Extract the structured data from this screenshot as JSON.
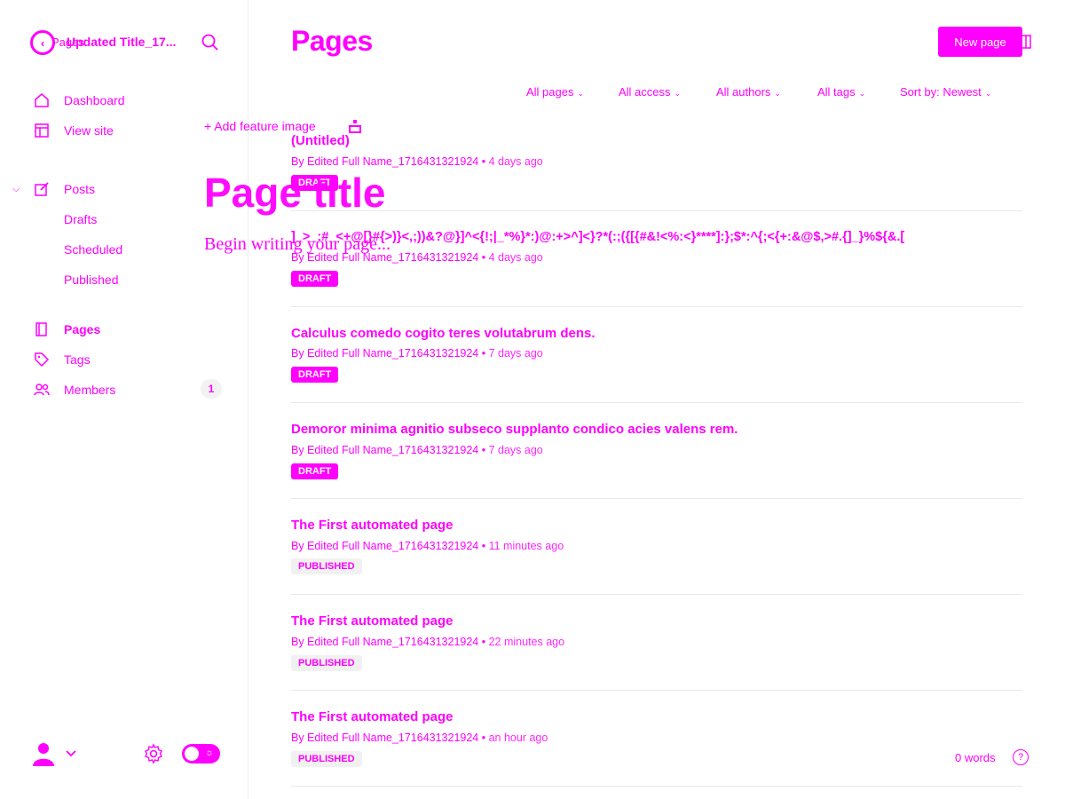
{
  "editor": {
    "back_label": "Pages",
    "breadcrumb_title": "Updated Title_17...",
    "add_feature_image": "Add feature image",
    "title_placeholder": "Page title",
    "body_placeholder": "Begin writing your page...",
    "word_count": "0 words",
    "help_icon": "?"
  },
  "sidebar": {
    "items": [
      {
        "label": "Dashboard",
        "icon": "home-icon"
      },
      {
        "label": "View site",
        "icon": "layout-icon"
      },
      {
        "label": "Posts",
        "icon": "edit-icon"
      },
      {
        "label": "Drafts"
      },
      {
        "label": "Scheduled"
      },
      {
        "label": "Published"
      },
      {
        "label": "Pages",
        "icon": "page-icon"
      },
      {
        "label": "Tags",
        "icon": "tag-icon"
      },
      {
        "label": "Members",
        "icon": "members-icon",
        "count": "1"
      }
    ]
  },
  "header": {
    "title": "Pages",
    "new_page_label": "New page"
  },
  "filters": {
    "pages": "All pages",
    "access": "All access",
    "authors": "All authors",
    "tags": "All tags",
    "sort": "Sort by: Newest"
  },
  "list": [
    {
      "title": "(Untitled)",
      "meta": "By Edited Full Name_1716431321924",
      "ago": "4 days ago",
      "status": "DRAFT"
    },
    {
      "title": "]_>_:#_<+@[}#{>)}<,;))&?@}]^<{!;|_*%}*:)@:+>^]<}?*(:;({[{#&!<%:<}****]:};$*:^{;<{+:&@$,>#.{]_}%${&.[",
      "meta": "By Edited Full Name_1716431321924",
      "ago": "4 days ago",
      "status": "DRAFT"
    },
    {
      "title": "Calculus comedo cogito teres volutabrum dens.",
      "meta": "By Edited Full Name_1716431321924",
      "ago": "7 days ago",
      "status": "DRAFT"
    },
    {
      "title": "Demoror minima agnitio subseco supplanto condico acies valens rem.",
      "meta": "By Edited Full Name_1716431321924",
      "ago": "7 days ago",
      "status": "DRAFT"
    },
    {
      "title": "The First automated page",
      "meta": "By Edited Full Name_1716431321924",
      "ago": "11 minutes ago",
      "status": "PUBLISHED"
    },
    {
      "title": "The First automated page",
      "meta": "By Edited Full Name_1716431321924",
      "ago": "22 minutes ago",
      "status": "PUBLISHED"
    },
    {
      "title": "The First automated page",
      "meta": "By Edited Full Name_1716431321924",
      "ago": "an hour ago",
      "status": "PUBLISHED"
    }
  ],
  "colors": {
    "accent": "#ff00ff",
    "badge_published_bg": "#f1f1f1"
  }
}
